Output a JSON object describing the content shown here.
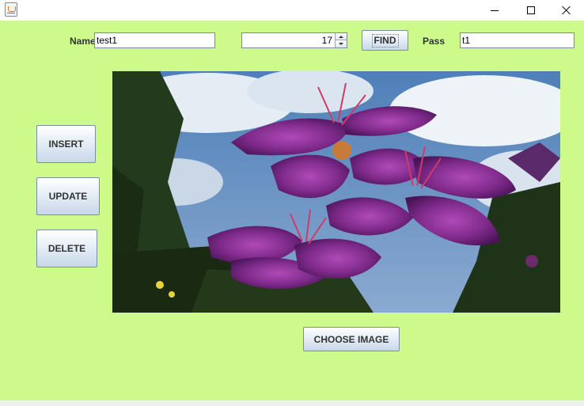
{
  "window": {
    "controls": {
      "minimize_icon": "minimize-icon",
      "maximize_icon": "maximize-icon",
      "close_icon": "close-icon"
    }
  },
  "form": {
    "name_label": "Name",
    "name_value": "test1",
    "id_value": "17",
    "find_label": "FIND",
    "pass_label": "Pass",
    "pass_value": "t1"
  },
  "actions": {
    "insert_label": "INSERT",
    "update_label": "UPDATE",
    "delete_label": "DELETE",
    "choose_image_label": "CHOOSE IMAGE"
  },
  "colors": {
    "panel_background": "#ccfb8c",
    "titlebar_background": "#ffffff"
  }
}
